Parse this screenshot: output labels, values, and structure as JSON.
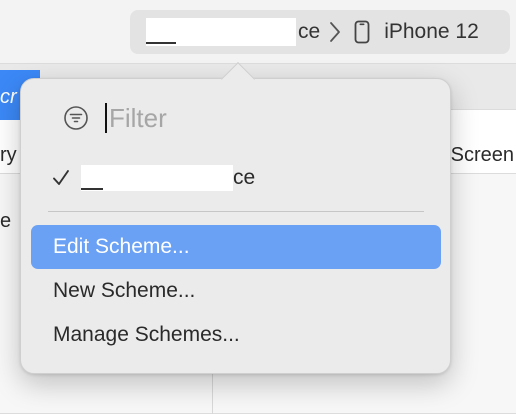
{
  "toolbar": {
    "scheme_suffix": "ce",
    "device_name": "iPhone 12"
  },
  "background": {
    "side_text_1": "cr",
    "side_text_2": "ry",
    "side_text_3": "e",
    "right_text": "Screen"
  },
  "popover": {
    "filter_placeholder": "Filter",
    "current_scheme_suffix": "ce",
    "menu": [
      {
        "label": "Edit Scheme...",
        "selected": true
      },
      {
        "label": "New Scheme...",
        "selected": false
      },
      {
        "label": "Manage Schemes...",
        "selected": false
      }
    ]
  },
  "colors": {
    "highlight": "#6aa1f5",
    "selector_bg": "#e3e3e3",
    "popover_bg": "#ebebeb"
  },
  "icons": {
    "filter": "filter-circle-icon",
    "chevron": "chevron-right-icon",
    "device": "iphone-icon",
    "check": "checkmark-icon"
  }
}
